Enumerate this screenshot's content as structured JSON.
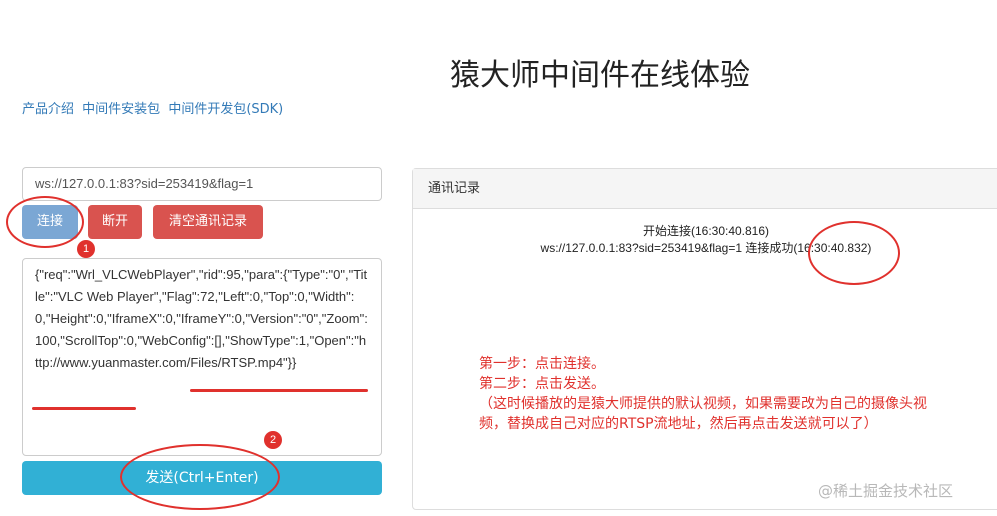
{
  "header": {
    "title": "猿大师中间件在线体验",
    "links": [
      "产品介绍",
      "中间件安装包",
      "中间件开发包(SDK)"
    ]
  },
  "connection": {
    "url_value": "ws://127.0.0.1:83?sid=253419&flag=1",
    "connect_label": "连接",
    "disconnect_label": "断开",
    "clear_label": "清空通讯记录"
  },
  "request": {
    "text": "{\"req\":\"Wrl_VLCWebPlayer\",\"rid\":95,\"para\":{\"Type\":\"0\",\"Title\":\"VLC Web Player\",\"Flag\":72,\"Left\":0,\"Top\":0,\"Width\":0,\"Height\":0,\"IframeX\":0,\"IframeY\":0,\"Version\":\"0\",\"Zoom\":100,\"ScrollTop\":0,\"WebConfig\":[],\"ShowType\":1,\"Open\":\"http://www.yuanmaster.com/Files/RTSP.mp4\"}}",
    "send_label": "发送(Ctrl+Enter)"
  },
  "log": {
    "heading": "通讯记录",
    "lines": [
      "开始连接(16:30:40.816)",
      "ws://127.0.0.1:83?sid=253419&flag=1 连接成功(16:30:40.832)"
    ]
  },
  "annotations": {
    "step1": "第一步：点击连接。",
    "step2": "第二步：点击发送。",
    "note": "（这时候播放的是猿大师提供的默认视频，如果需要改为自己的摄像头视频，替换成自己对应的RTSP流地址，然后再点击发送就可以了）",
    "badge1": "1",
    "badge2": "2"
  },
  "watermark": "@稀土掘金技术社区",
  "colors": {
    "annotation_red": "#e0312d",
    "connect_button": "#7ba7d4",
    "danger_button": "#d9534f",
    "send_button": "#31b0d5",
    "link_blue": "#337ab7"
  }
}
